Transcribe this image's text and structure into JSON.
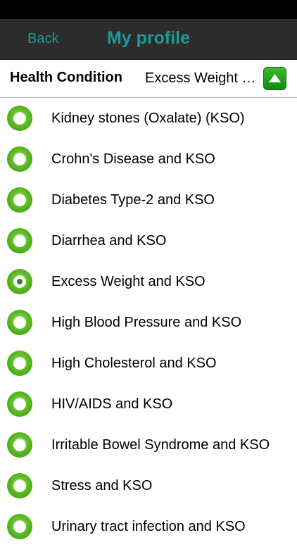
{
  "nav": {
    "back_label": "Back",
    "title": "My profile"
  },
  "condition": {
    "label": "Health Condition",
    "value": "Excess Weight and KSO"
  },
  "colors": {
    "accent": "#1b9a96",
    "radio_green": "#54b51f",
    "button_green": "#169e18"
  },
  "options": [
    {
      "label": "Kidney stones (Oxalate) (KSO)",
      "selected": false
    },
    {
      "label": "Crohn's Disease and KSO",
      "selected": false
    },
    {
      "label": "Diabetes Type-2 and KSO",
      "selected": false
    },
    {
      "label": "Diarrhea and KSO",
      "selected": false
    },
    {
      "label": "Excess Weight and KSO",
      "selected": true
    },
    {
      "label": "High Blood Pressure and KSO",
      "selected": false
    },
    {
      "label": "High Cholesterol and KSO",
      "selected": false
    },
    {
      "label": "HIV/AIDS and KSO",
      "selected": false
    },
    {
      "label": "Irritable Bowel Syndrome and KSO",
      "selected": false
    },
    {
      "label": "Stress and KSO",
      "selected": false
    },
    {
      "label": "Urinary tract infection and KSO",
      "selected": false
    }
  ]
}
